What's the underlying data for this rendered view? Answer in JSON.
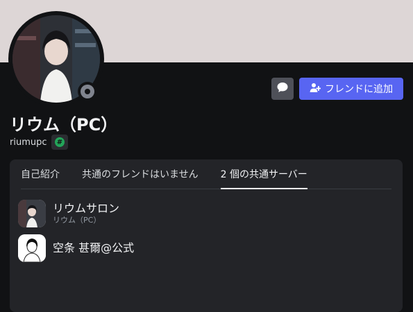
{
  "profile": {
    "display_name": "リウム（PC）",
    "username": "riumupc",
    "badge_symbol": "#",
    "status": "offline",
    "colors": {
      "banner": "#ddd6d6",
      "background": "#111214",
      "panel": "#232428",
      "accent": "#5865f2",
      "badge": "#23a559"
    }
  },
  "actions": {
    "message_icon": "message-bubble-icon",
    "add_friend_label": "フレンドに追加",
    "add_friend_icon": "add-friend-icon"
  },
  "tabs": [
    {
      "label": "自己紹介",
      "active": false
    },
    {
      "label": "共通のフレンドはいません",
      "active": false
    },
    {
      "label": "2 個の共通サーバー",
      "active": true
    }
  ],
  "servers": [
    {
      "name": "リウムサロン",
      "subtitle": "リウム（PC）"
    },
    {
      "name": "空条 甚爾@公式",
      "subtitle": ""
    }
  ]
}
